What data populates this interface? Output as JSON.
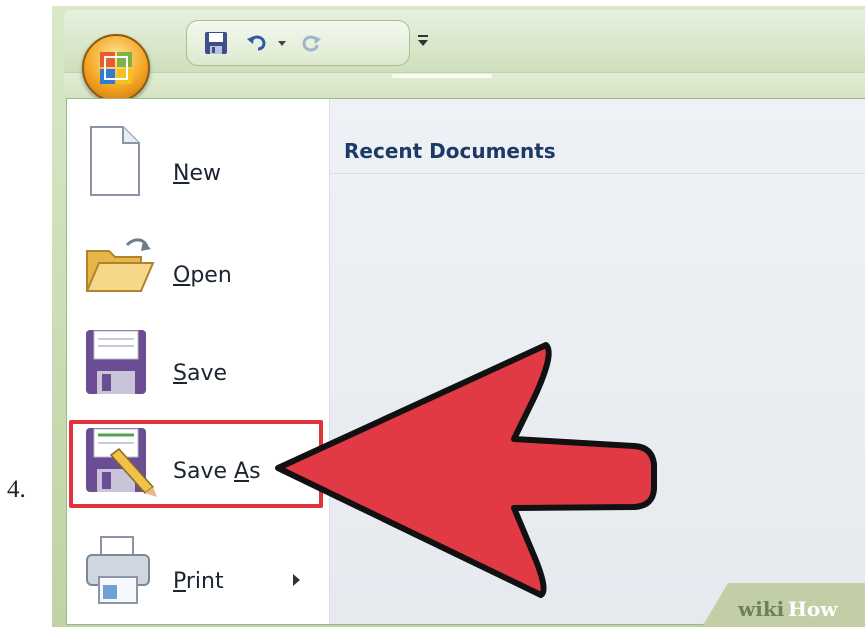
{
  "step": {
    "number": "4."
  },
  "title_bar": {
    "quick_access": [
      {
        "icon": "save-icon"
      },
      {
        "icon": "undo-icon"
      },
      {
        "icon": "dropdown-icon"
      },
      {
        "icon": "redo-icon"
      }
    ],
    "overflow_icon": "customize-toolbar-icon"
  },
  "office_button": {
    "icon": "office-logo-icon",
    "color": "#f5a623"
  },
  "menu": {
    "items": [
      {
        "mnemonic": "N",
        "rest": "ew",
        "icon": "new-document-icon"
      },
      {
        "mnemonic": "O",
        "rest": "pen",
        "icon": "open-folder-icon"
      },
      {
        "mnemonic": "S",
        "rest": "ave",
        "icon": "floppy-disk-icon"
      },
      {
        "prefix": "Save ",
        "mnemonic": "A",
        "rest": "s",
        "icon": "save-as-icon"
      },
      {
        "mnemonic": "P",
        "rest": "rint",
        "icon": "printer-icon"
      }
    ]
  },
  "recent": {
    "title": "Recent Documents"
  },
  "annotation": {
    "highlight_color": "#e0343a",
    "arrow_color": "#e23a45"
  },
  "watermark": {
    "wiki": "wiki",
    "how": "How"
  }
}
